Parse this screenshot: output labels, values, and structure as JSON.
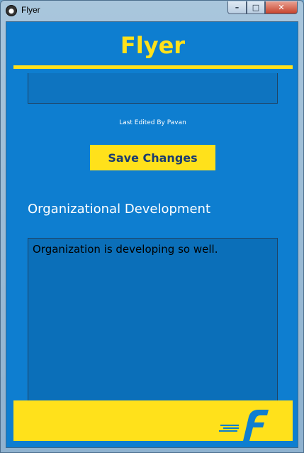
{
  "window": {
    "title": "Flyer",
    "controls": {
      "minimize": "–",
      "maximize": "□",
      "close": "✕"
    }
  },
  "header": {
    "brand": "Flyer"
  },
  "editor": {
    "last_edited": "Last Edited By Pavan",
    "save_label": "Save Changes"
  },
  "section": {
    "heading": "Organizational Development",
    "content": "Organization is developing so well."
  },
  "colors": {
    "background": "#0e7ed0",
    "accent": "#ffe11b",
    "button_text": "#1b3b6f"
  },
  "icons": {
    "app": "flyer-app-icon",
    "footer_logo": "flipkart-f-logo"
  }
}
